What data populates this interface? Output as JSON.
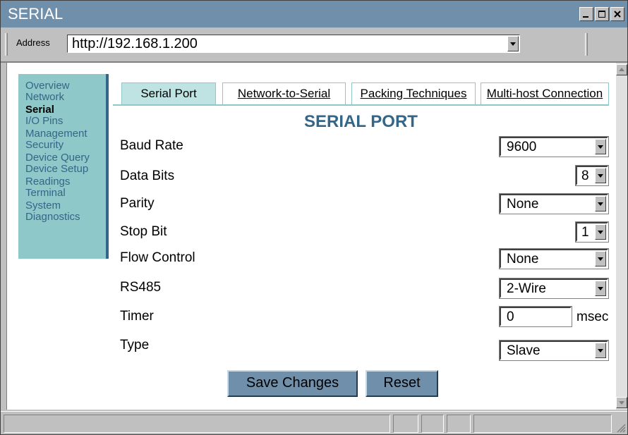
{
  "window": {
    "title": "SERIAL"
  },
  "addressbar": {
    "label": "Address",
    "url": "http://192.168.1.200"
  },
  "sidebar": {
    "items": [
      {
        "label": "Overview",
        "active": false
      },
      {
        "label": "Network",
        "active": false
      },
      {
        "label": "Serial",
        "active": true
      },
      {
        "label": "I/O Pins",
        "active": false
      },
      {
        "label": "Management",
        "active": false
      },
      {
        "label": "Security",
        "active": false
      },
      {
        "label": "Device Query",
        "active": false
      },
      {
        "label": "Device Setup",
        "active": false
      },
      {
        "label": "Readings",
        "active": false
      },
      {
        "label": "Terminal",
        "active": false
      },
      {
        "label": "System",
        "active": false
      },
      {
        "label": "Diagnostics",
        "active": false
      }
    ]
  },
  "tabs": [
    {
      "label": "Serial Port",
      "active": true
    },
    {
      "label": "Network-to-Serial",
      "active": false
    },
    {
      "label": "Packing Techniques",
      "active": false
    },
    {
      "label": "Multi-host Connection",
      "active": false
    }
  ],
  "main": {
    "title": "SERIAL PORT",
    "fields": {
      "baud_rate": {
        "label": "Baud Rate",
        "value": "9600"
      },
      "data_bits": {
        "label": "Data Bits",
        "value": "8"
      },
      "parity": {
        "label": "Parity",
        "value": "None"
      },
      "stop_bit": {
        "label": "Stop Bit",
        "value": "1"
      },
      "flow_control": {
        "label": "Flow Control",
        "value": "None"
      },
      "rs485": {
        "label": "RS485",
        "value": "2-Wire"
      },
      "timer": {
        "label": "Timer",
        "value": "0",
        "unit": "msec"
      },
      "type": {
        "label": "Type",
        "value": "Slave"
      }
    },
    "buttons": {
      "save": "Save Changes",
      "reset": "Reset"
    }
  },
  "colors": {
    "titlebar": "#6f8faa",
    "sidebar_bg": "#8fc8c8",
    "accent": "#336688",
    "active_tab": "#bfe3e3",
    "button": "#6f8faa"
  }
}
